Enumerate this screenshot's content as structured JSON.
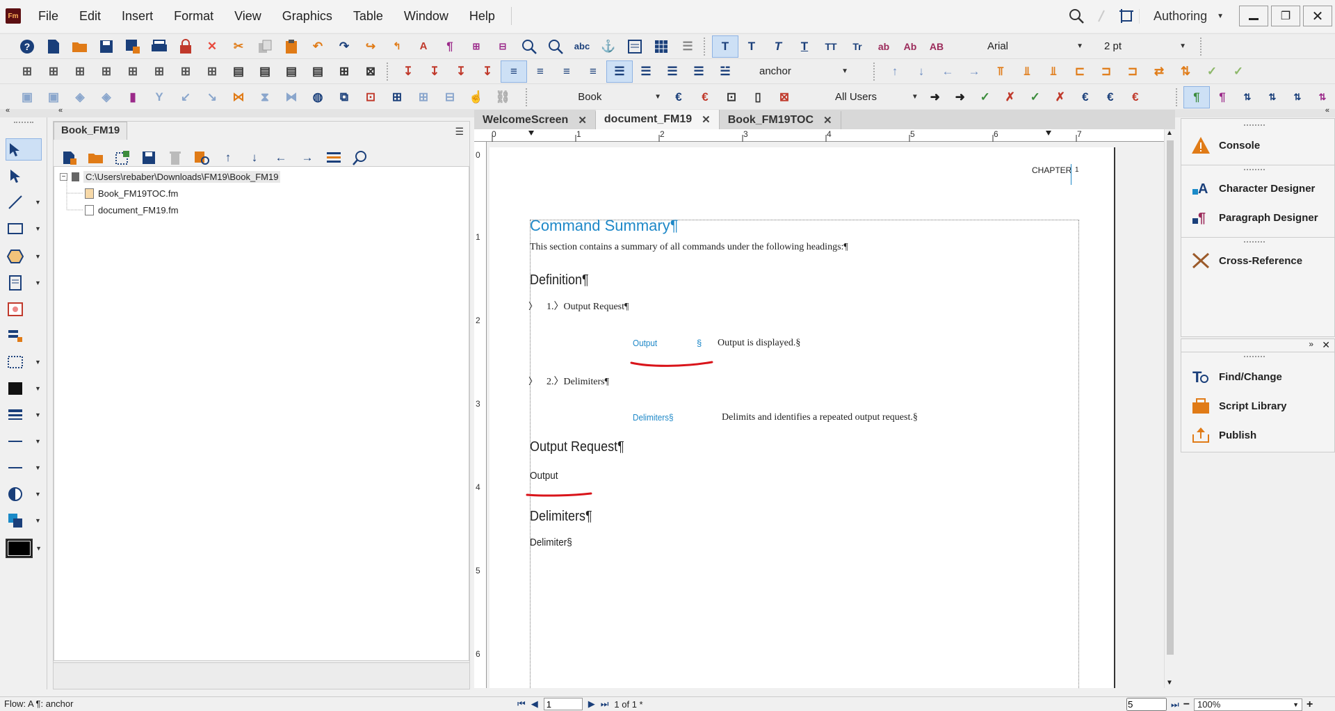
{
  "app": {
    "logo": "Fm",
    "workspace": "Authoring"
  },
  "menu": [
    "File",
    "Edit",
    "Insert",
    "Format",
    "View",
    "Graphics",
    "Table",
    "Window",
    "Help"
  ],
  "toolbar": {
    "font": "Arial",
    "size": "2 pt",
    "char_format": "anchor",
    "para_format": "Book",
    "tracking_user": "All Users",
    "text_style_labels": [
      "ab",
      "Ab",
      "AB"
    ]
  },
  "book_panel": {
    "tab": "Book_FM19",
    "root_path": "C:\\Users\\rebaber\\Downloads\\FM19\\Book_FM19",
    "files": [
      "Book_FM19TOC.fm",
      "document_FM19.fm"
    ]
  },
  "doc_tabs": [
    {
      "label": "WelcomeScreen",
      "active": false
    },
    {
      "label": "document_FM19",
      "active": true
    },
    {
      "label": "Book_FM19TOC",
      "active": false
    }
  ],
  "ruler": {
    "h_ticks": [
      "0",
      "1",
      "2",
      "3",
      "4",
      "5",
      "6",
      "7"
    ],
    "v_ticks": [
      "0",
      "1",
      "2",
      "3",
      "4",
      "5",
      "6"
    ]
  },
  "page": {
    "header_chapter": "CHAPTER",
    "header_num": "1",
    "title": "Command Summary¶",
    "intro": "This section contains a summary of all commands under the following headings:¶",
    "h_definition": "Definition¶",
    "item1": "1.〉Output Request¶",
    "item1_marker": "〉",
    "def1_term": "Output",
    "def1_sect": "§",
    "def1_desc": "Output is displayed.§",
    "item2": "2.〉Delimiters¶",
    "item2_marker": "〉",
    "def2_term": "Delimiters§",
    "def2_desc": "Delimits and identifies a repeated output request.§",
    "h_output": "Output Request¶",
    "output_text": "Output",
    "h_delims": "Delimiters¶",
    "delims_text": "Delimiter§"
  },
  "right_panels": {
    "top": [
      "Console",
      "Character Designer",
      "Paragraph Designer",
      "Cross-Reference"
    ],
    "bottom": [
      "Find/Change",
      "Script Library",
      "Publish"
    ]
  },
  "status": {
    "flow": "Flow: A  ¶: anchor",
    "page_input": "1",
    "page_of": "1 of 1 *",
    "goto_input": "5",
    "zoom": "100%"
  },
  "colors": {
    "accent": "#1e88c8",
    "annotation": "#d9141a",
    "icon_blue": "#1a3f7a",
    "icon_orange": "#e07b17"
  }
}
